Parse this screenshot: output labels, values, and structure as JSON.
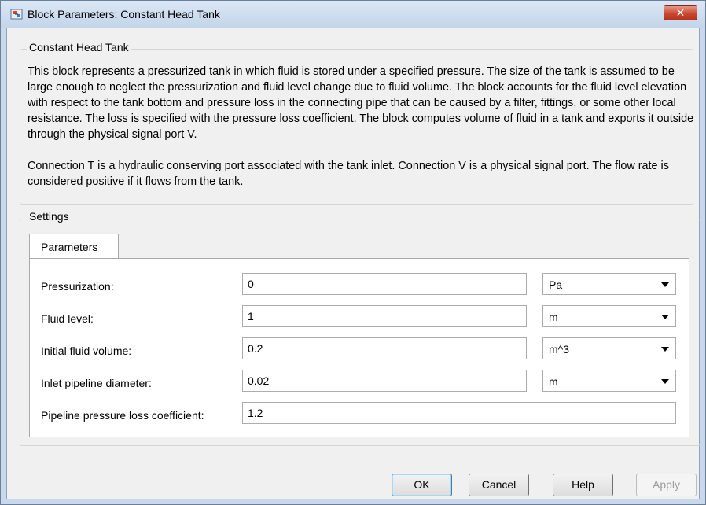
{
  "window": {
    "title": "Block Parameters: Constant Head Tank",
    "close_glyph": "✕"
  },
  "description": {
    "group_label": "Constant Head Tank",
    "paragraph1": "This block represents a pressurized tank in which fluid is stored under a specified pressure. The size of the tank is assumed to be large enough to neglect the pressurization and fluid level change due to fluid volume. The block accounts for the fluid level elevation with respect to the tank bottom and pressure loss in the connecting pipe that can be caused by a filter, fittings, or some other local resistance. The loss is specified with the pressure loss coefficient. The block computes volume of fluid in a tank and exports it outside through the physical signal port V.",
    "paragraph2": "Connection T is a hydraulic conserving port associated with the tank inlet. Connection V is a physical signal port. The flow rate is considered positive if it flows from the tank."
  },
  "settings": {
    "group_label": "Settings",
    "tab_label": "Parameters",
    "params": [
      {
        "label": "Pressurization:",
        "value": "0",
        "unit": "Pa"
      },
      {
        "label": "Fluid level:",
        "value": "1",
        "unit": "m"
      },
      {
        "label": "Initial fluid volume:",
        "value": "0.2",
        "unit": "m^3"
      },
      {
        "label": "Inlet pipeline diameter:",
        "value": "0.02",
        "unit": "m"
      },
      {
        "label": "Pipeline pressure loss coefficient:",
        "value": "1.2"
      }
    ]
  },
  "buttons": {
    "ok": "OK",
    "cancel": "Cancel",
    "help": "Help",
    "apply": "Apply"
  }
}
